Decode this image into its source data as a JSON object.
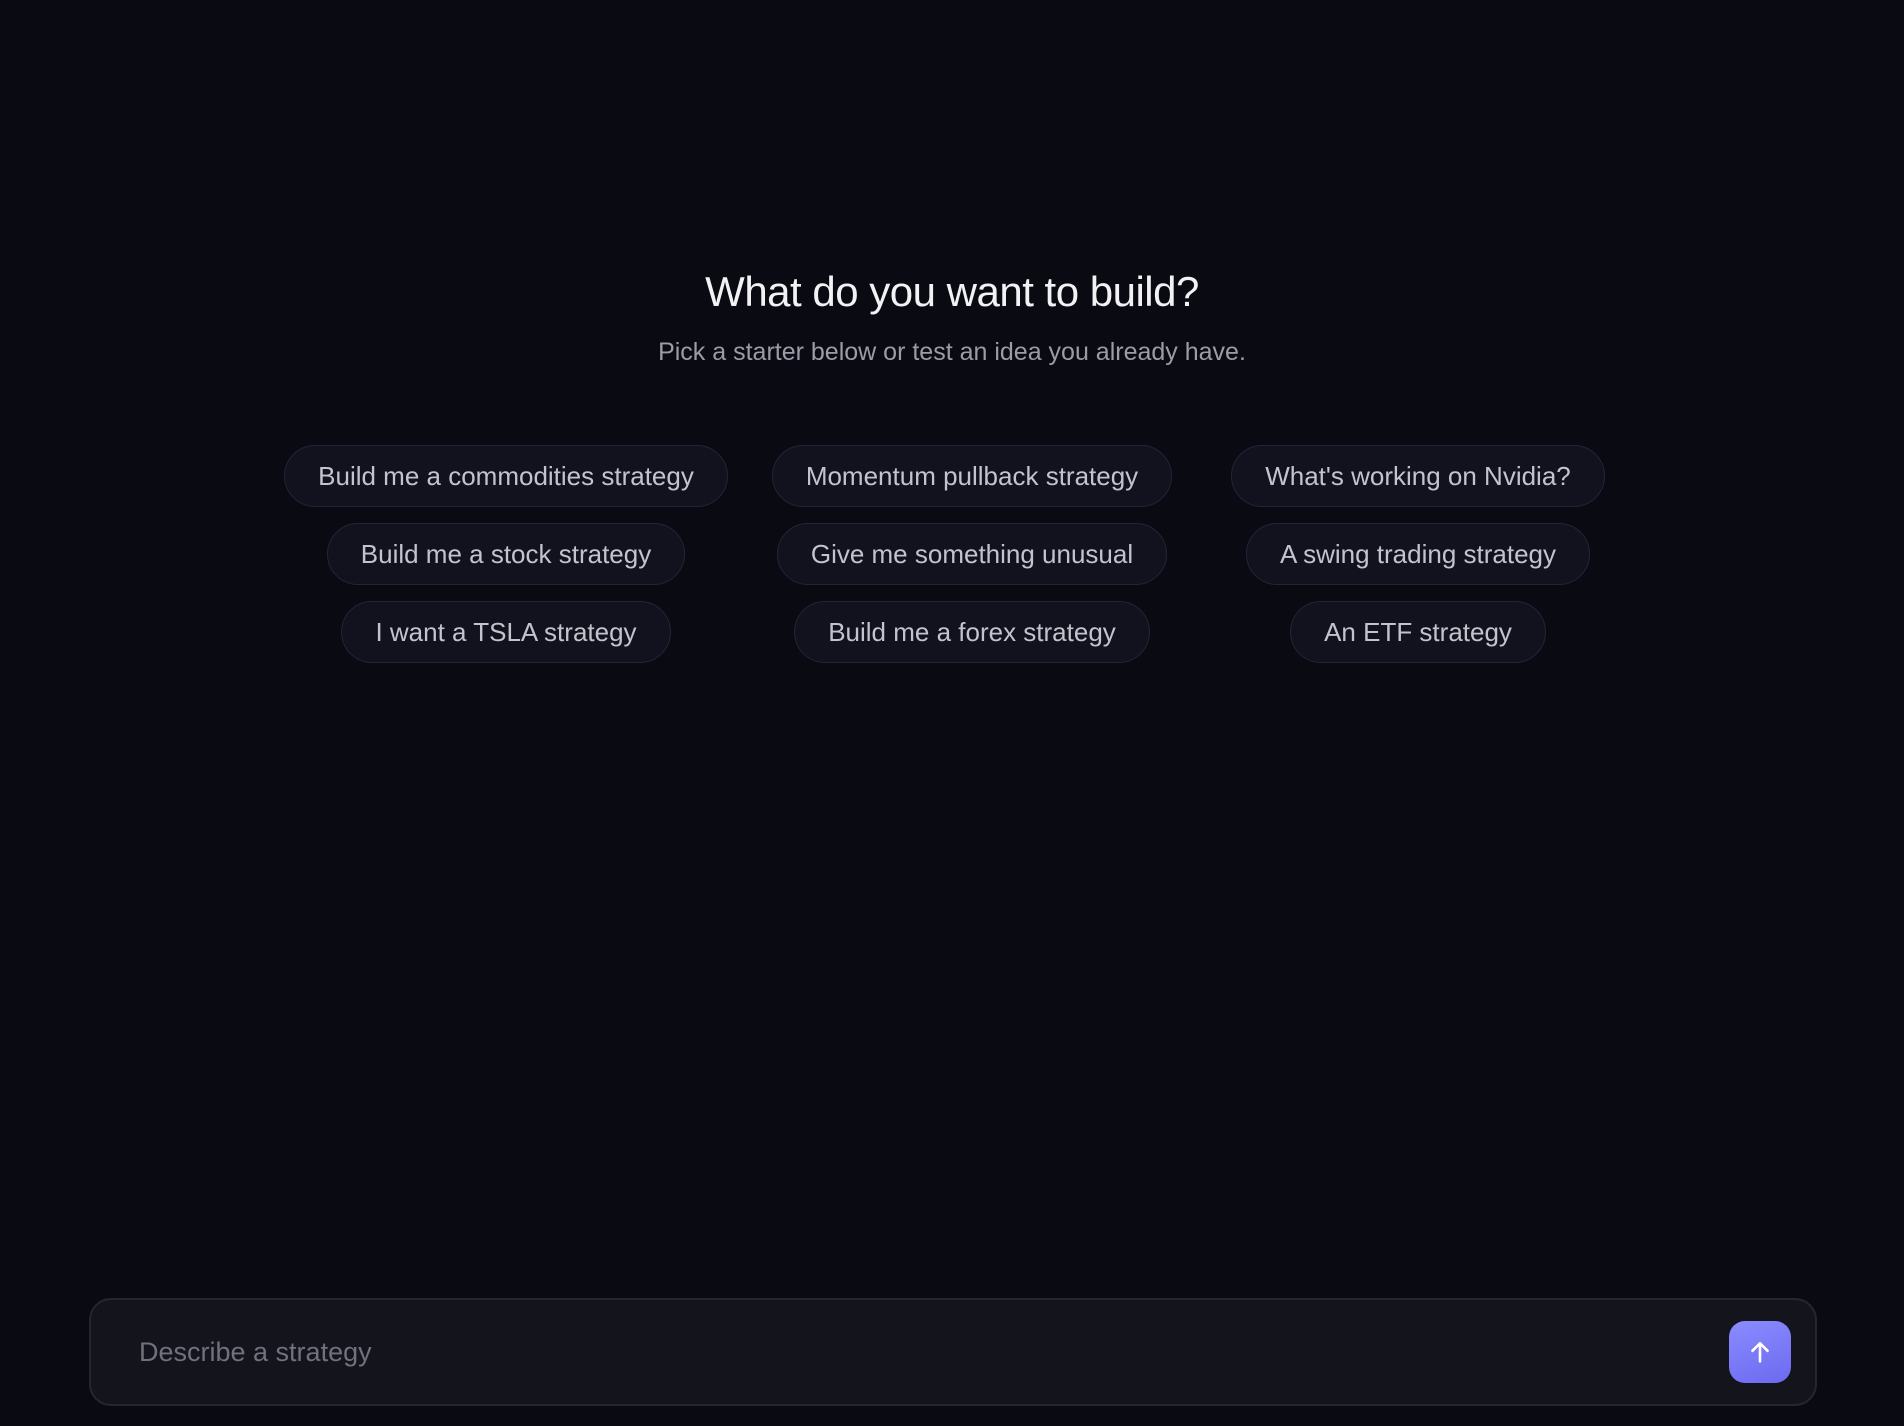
{
  "hero": {
    "title": "What do you want to build?",
    "subtitle": "Pick a starter below or test an idea you already have."
  },
  "starters": [
    "Build me a commodities strategy",
    "Momentum pullback strategy",
    "What's working on Nvidia?",
    "Build me a stock strategy",
    "Give me something unusual",
    "A swing trading strategy",
    "I want a TSLA strategy",
    "Build me a forex strategy",
    "An ETF strategy"
  ],
  "composer": {
    "placeholder": "Describe a strategy",
    "value": ""
  },
  "icons": {
    "send": "arrow-up-icon"
  },
  "colors": {
    "background": "#0a0b12",
    "accent": "#7b7bf7"
  }
}
